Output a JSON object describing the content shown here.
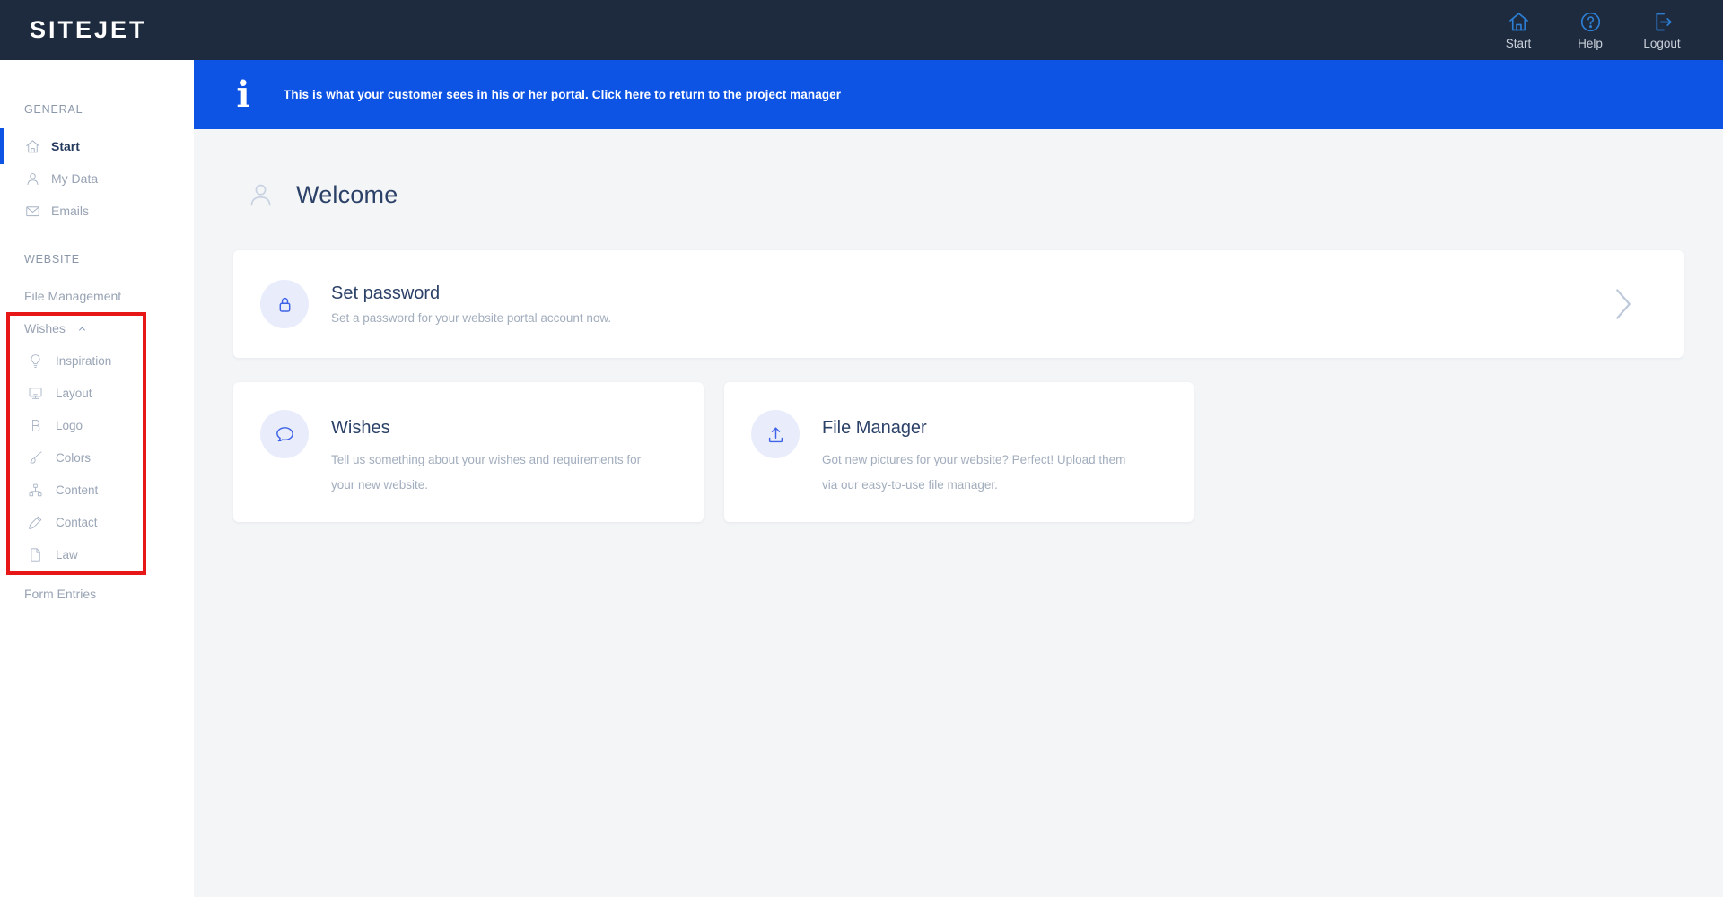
{
  "topbar": {
    "logo": "SITEJET",
    "nav": [
      {
        "label": "Start",
        "icon": "home-icon"
      },
      {
        "label": "Help",
        "icon": "help-circle-icon"
      },
      {
        "label": "Logout",
        "icon": "logout-icon"
      }
    ]
  },
  "banner": {
    "info_glyph": "i",
    "icon": "info-icon",
    "message": "This is what your customer sees in his or her portal.",
    "link_label": "Click here to return to the project manager"
  },
  "sidebar": {
    "general_title": "GENERAL",
    "general_items": [
      {
        "label": "Start",
        "icon": "home-icon",
        "active": true
      },
      {
        "label": "My Data",
        "icon": "user-icon",
        "active": false
      },
      {
        "label": "Emails",
        "icon": "envelope-icon",
        "active": false
      }
    ],
    "website_title": "WEBSITE",
    "file_management_label": "File Management",
    "wishes_label": "Wishes",
    "wishes_expanded": true,
    "wishes_submenu": [
      {
        "label": "Inspiration",
        "icon": "lightbulb-icon"
      },
      {
        "label": "Layout",
        "icon": "monitor-icon"
      },
      {
        "label": "Logo",
        "icon": "logo-b-icon"
      },
      {
        "label": "Colors",
        "icon": "paintbrush-icon"
      },
      {
        "label": "Content",
        "icon": "sitemap-icon"
      },
      {
        "label": "Contact",
        "icon": "pen-icon"
      },
      {
        "label": "Law",
        "icon": "document-icon"
      }
    ],
    "form_entries_label": "Form Entries"
  },
  "main": {
    "welcome_title": "Welcome",
    "welcome_icon": "user-icon",
    "set_password_card": {
      "icon": "lock-icon",
      "title": "Set password",
      "description": "Set a password for your website portal account now."
    },
    "wishes_card": {
      "icon": "speech-bubble-icon",
      "title": "Wishes",
      "description": "Tell us something about your wishes and requirements for your new website."
    },
    "file_manager_card": {
      "icon": "upload-icon",
      "title": "File Manager",
      "description": "Got new pictures for your website? Perfect! Upload them via our easy-to-use file manager."
    }
  },
  "annotation": {
    "highlight_box_color": "#e81717"
  },
  "colors": {
    "topbar_bg": "#1e2b3e",
    "banner_bg": "#0d53e4",
    "topbar_icon_blue": "#2d7ed3",
    "accent_blue": "#0d53e4",
    "card_icon_blue": "#3f63e8",
    "heading_navy": "#2c4168",
    "muted_text": "#9aa5b6",
    "main_bg": "#f3f5f7",
    "highlight_red": "#e81717"
  }
}
